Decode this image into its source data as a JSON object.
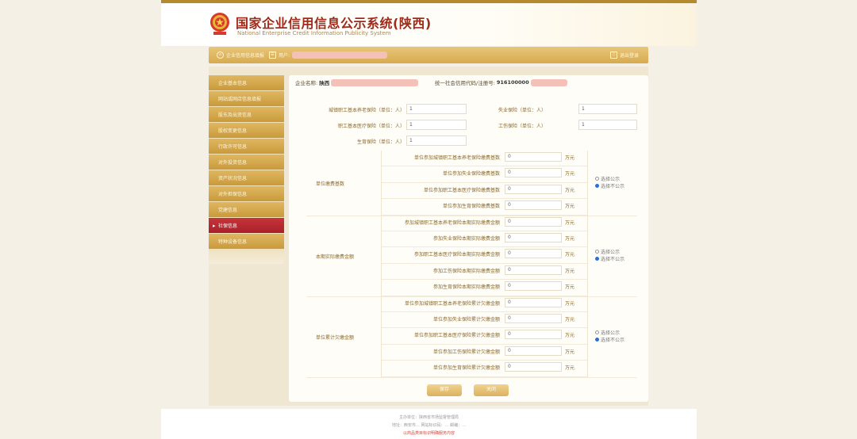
{
  "header": {
    "title": "国家企业信用信息公示系统(陕西)",
    "subtitle": "National Enterprise Credit Information Publicity System"
  },
  "navbar": {
    "item_left": "企业信用信息填报",
    "item_user": "用户:",
    "item_right": "退出登录"
  },
  "sidebar": {
    "items": [
      {
        "label": "企业基本信息"
      },
      {
        "label": "网站或网店信息填报"
      },
      {
        "label": "股东及出资信息"
      },
      {
        "label": "股权变更信息"
      },
      {
        "label": "行政许可信息"
      },
      {
        "label": "对外投资信息"
      },
      {
        "label": "资产状况信息"
      },
      {
        "label": "对外担保信息"
      },
      {
        "label": "党建信息"
      },
      {
        "label": "社保信息"
      },
      {
        "label": "特种设备信息"
      }
    ],
    "active_index": 9
  },
  "enterprise": {
    "name_label": "企业名称:",
    "name_value": "陕西",
    "code_label": "统一社会信用代码/注册号:",
    "code_value": "916100000"
  },
  "headcount": {
    "pension_label": "城镇职工基本养老保险（单位：人）",
    "pension_value": "1",
    "unemployment_label": "失业保险（单位：人）",
    "unemployment_value": "1",
    "medical_label": "职工基本医疗保险（单位：人）",
    "medical_value": "1",
    "injury_label": "工伤保险（单位：人）",
    "injury_value": "1",
    "maternity_label": "生育保险（单位：人）",
    "maternity_value": "1"
  },
  "groups": [
    {
      "label": "单位缴费基数",
      "rows": [
        {
          "label": "单位参加城镇职工基本养老保险缴费基数",
          "value": "0",
          "unit": "万元"
        },
        {
          "label": "单位参加失业保险缴费基数",
          "value": "0",
          "unit": "万元"
        },
        {
          "label": "单位参加职工基本医疗保险缴费基数",
          "value": "0",
          "unit": "万元"
        },
        {
          "label": "单位参加生育保险缴费基数",
          "value": "0",
          "unit": "万元"
        }
      ],
      "radio_public": "选择公示",
      "radio_private": "选择不公示",
      "selected": "private"
    },
    {
      "label": "本期实际缴费金额",
      "rows": [
        {
          "label": "参加城镇职工基本养老保险本期实际缴费金额",
          "value": "0",
          "unit": "万元"
        },
        {
          "label": "参加失业保险本期实际缴费金额",
          "value": "0",
          "unit": "万元"
        },
        {
          "label": "参加职工基本医疗保险本期实际缴费金额",
          "value": "0",
          "unit": "万元"
        },
        {
          "label": "参加工伤保险本期实际缴费金额",
          "value": "0",
          "unit": "万元"
        },
        {
          "label": "参加生育保险本期实际缴费金额",
          "value": "0",
          "unit": "万元"
        }
      ],
      "radio_public": "选择公示",
      "radio_private": "选择不公示",
      "selected": "private"
    },
    {
      "label": "单位累计欠缴金额",
      "rows": [
        {
          "label": "单位参加城镇职工基本养老保险累计欠缴金额",
          "value": "0",
          "unit": "万元"
        },
        {
          "label": "单位参加失业保险累计欠缴金额",
          "value": "0",
          "unit": "万元"
        },
        {
          "label": "单位参加职工基本医疗保险累计欠缴金额",
          "value": "0",
          "unit": "万元"
        },
        {
          "label": "单位参加工伤保险累计欠缴金额",
          "value": "0",
          "unit": "万元"
        },
        {
          "label": "单位参加生育保险累计欠缴金额",
          "value": "0",
          "unit": "万元"
        }
      ],
      "radio_public": "选择公示",
      "radio_private": "选择不公示",
      "selected": "private"
    }
  ],
  "buttons": {
    "save": "保存",
    "close": "关闭"
  },
  "footer": {
    "line1": "主办单位：陕西省市场监督管理局",
    "line2": "地址：西安市…  网站标识码：…  邮编：…",
    "line3": "以商品类目标识明确服务内容"
  }
}
